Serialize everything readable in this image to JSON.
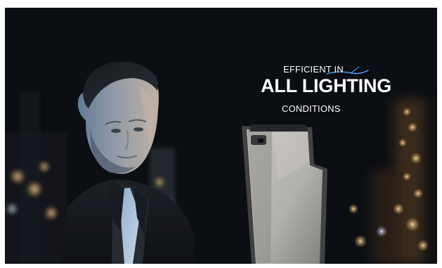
{
  "headline": {
    "line1": "EFFICIENT IN",
    "line2": "ALL LIGHTING",
    "line3": "CONDITIONS"
  },
  "colors": {
    "text": "#ffffff",
    "accent": "#4da3ff",
    "night_background": "#0b0f14"
  }
}
